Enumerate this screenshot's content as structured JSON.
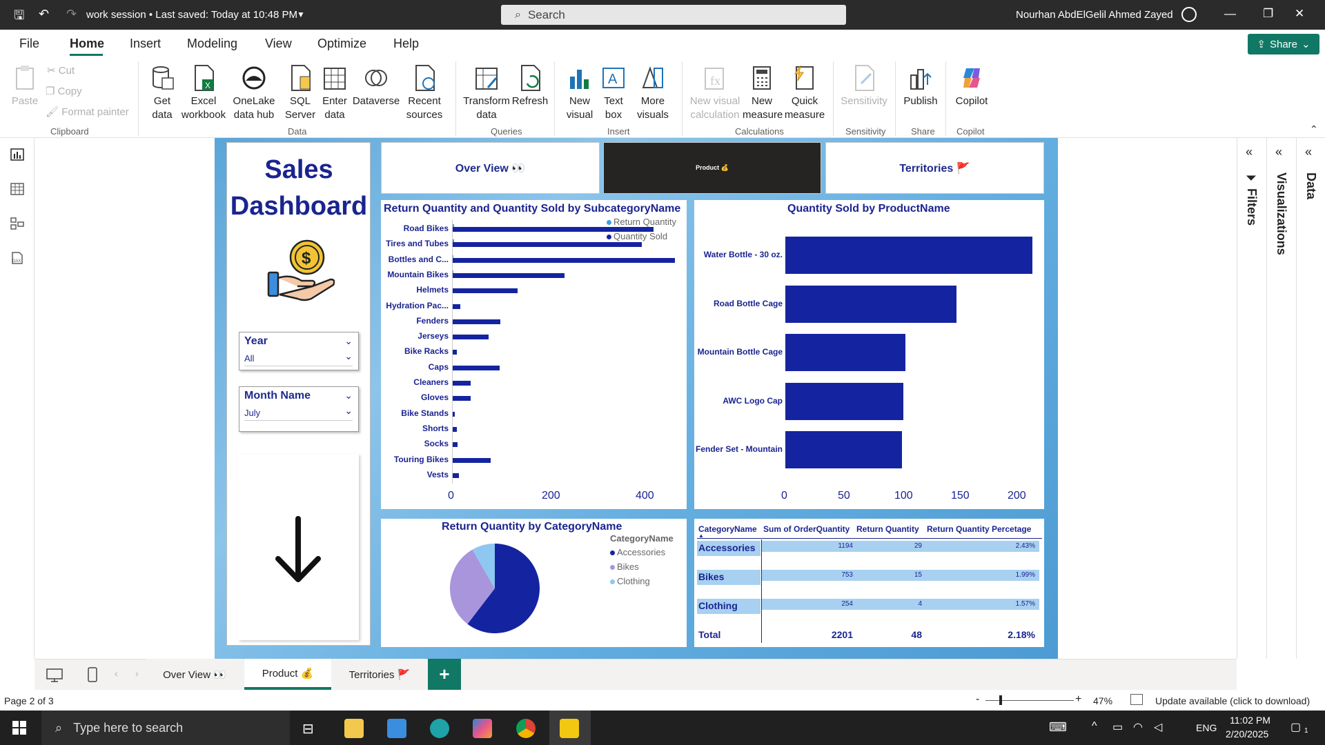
{
  "titlebar": {
    "title": "work session  •  Last saved: Today at 10:48 PM",
    "search_placeholder": "Search",
    "user": "Nourhan AbdElGelil Ahmed Zayed"
  },
  "menu": {
    "file": "File",
    "home": "Home",
    "insert": "Insert",
    "modeling": "Modeling",
    "view": "View",
    "optimize": "Optimize",
    "help": "Help",
    "share": "Share"
  },
  "ribbon": {
    "clipboard": {
      "paste": "Paste",
      "cut": "Cut",
      "copy": "Copy",
      "format_painter": "Format painter",
      "group": "Clipboard"
    },
    "data": {
      "get_data": "Get data",
      "excel": "Excel workbook",
      "onelake": "OneLake data hub",
      "sql": "SQL Server",
      "enter": "Enter data",
      "dataverse": "Dataverse",
      "recent": "Recent sources",
      "group": "Data"
    },
    "queries": {
      "transform": "Transform data",
      "refresh": "Refresh",
      "group": "Queries"
    },
    "insert": {
      "new_visual": "New visual",
      "text_box": "Text box",
      "more_visuals": "More visuals",
      "group": "Insert"
    },
    "calculations": {
      "new_visual_calc": "New visual calculation",
      "new_measure": "New measure",
      "quick_measure": "Quick measure",
      "group": "Calculations"
    },
    "sensitivity": {
      "sensitivity": "Sensitivity",
      "group": "Sensitivity"
    },
    "share": {
      "publish": "Publish",
      "group": "Share"
    },
    "copilot": {
      "copilot": "Copilot",
      "group": "Copilot"
    }
  },
  "report": {
    "title": "Sales Dashboard",
    "nav": {
      "overview": "Over View 👀",
      "product": "Product 💰",
      "territories": "Territories 🚩"
    },
    "slicers": {
      "year": {
        "label": "Year",
        "value": "All"
      },
      "month": {
        "label": "Month Name",
        "value": "July"
      }
    }
  },
  "chart_data": [
    {
      "type": "bar",
      "title": "Return Quantity and Quantity Sold by SubcategoryName",
      "orientation": "horizontal",
      "categories": [
        "Road Bikes",
        "Tires and Tubes",
        "Bottles and C...",
        "Mountain Bikes",
        "Helmets",
        "Hydration Pac...",
        "Fenders",
        "Jerseys",
        "Bike Racks",
        "Caps",
        "Cleaners",
        "Gloves",
        "Bike Stands",
        "Shorts",
        "Socks",
        "Touring Bikes",
        "Vests"
      ],
      "series": [
        {
          "name": "Return Quantity",
          "color": "#3aa0e8",
          "values": [
            5,
            4,
            3,
            3,
            2,
            1,
            1,
            1,
            1,
            1,
            1,
            1,
            0,
            1,
            0,
            0,
            0
          ]
        },
        {
          "name": "Quantity Sold",
          "color": "#1424a0",
          "values": [
            430,
            405,
            475,
            240,
            140,
            18,
            103,
            78,
            10,
            102,
            40,
            40,
            6,
            10,
            12,
            82,
            15
          ]
        }
      ],
      "xticks": [
        "0",
        "200",
        "400"
      ],
      "xlim": [
        0,
        500
      ],
      "legend": "top-right"
    },
    {
      "type": "bar",
      "title": "Quantity Sold by ProductName",
      "orientation": "horizontal",
      "categories": [
        "Water Bottle - 30 oz.",
        "Road Bottle Cage",
        "Mountain Bottle Cage",
        "AWC Logo Cap",
        "Fender Set - Mountain"
      ],
      "series": [
        {
          "name": "Quantity Sold",
          "color": "#1424a0",
          "values": [
            218,
            151,
            106,
            104,
            103
          ]
        }
      ],
      "xticks": [
        "0",
        "50",
        "100",
        "150",
        "200"
      ],
      "xlim": [
        0,
        225
      ]
    },
    {
      "type": "pie",
      "title": "Return Quantity by CategoryName",
      "legend_title": "CategoryName",
      "categories": [
        "Accessories",
        "Bikes",
        "Clothing"
      ],
      "values": [
        29,
        15,
        4
      ],
      "colors": [
        "#1424a0",
        "#a895dc",
        "#8ec8f0"
      ],
      "legend": "right"
    },
    {
      "type": "table",
      "columns": [
        "CategoryName",
        "Sum of OrderQuantity",
        "Return Quantity",
        "Return Quantity Percetage"
      ],
      "rows": [
        [
          "Accessories",
          "1194",
          "29",
          "2.43%"
        ],
        [
          "Bikes",
          "753",
          "15",
          "1.99%"
        ],
        [
          "Clothing",
          "254",
          "4",
          "1.57%"
        ]
      ],
      "total": [
        "Total",
        "2201",
        "48",
        "2.18%"
      ]
    }
  ],
  "panes": {
    "filters": "Filters",
    "visualizations": "Visualizations",
    "data": "Data"
  },
  "pages": {
    "overview": "Over View 👀",
    "product": "Product 💰",
    "territories": "Territories 🚩"
  },
  "status": {
    "page": "Page 2 of 3",
    "zoom": "47%",
    "update": "Update available (click to download)"
  },
  "taskbar": {
    "search": "Type here to search",
    "lang": "ENG",
    "time": "11:02 PM",
    "date": "2/20/2025",
    "notif": "1"
  }
}
